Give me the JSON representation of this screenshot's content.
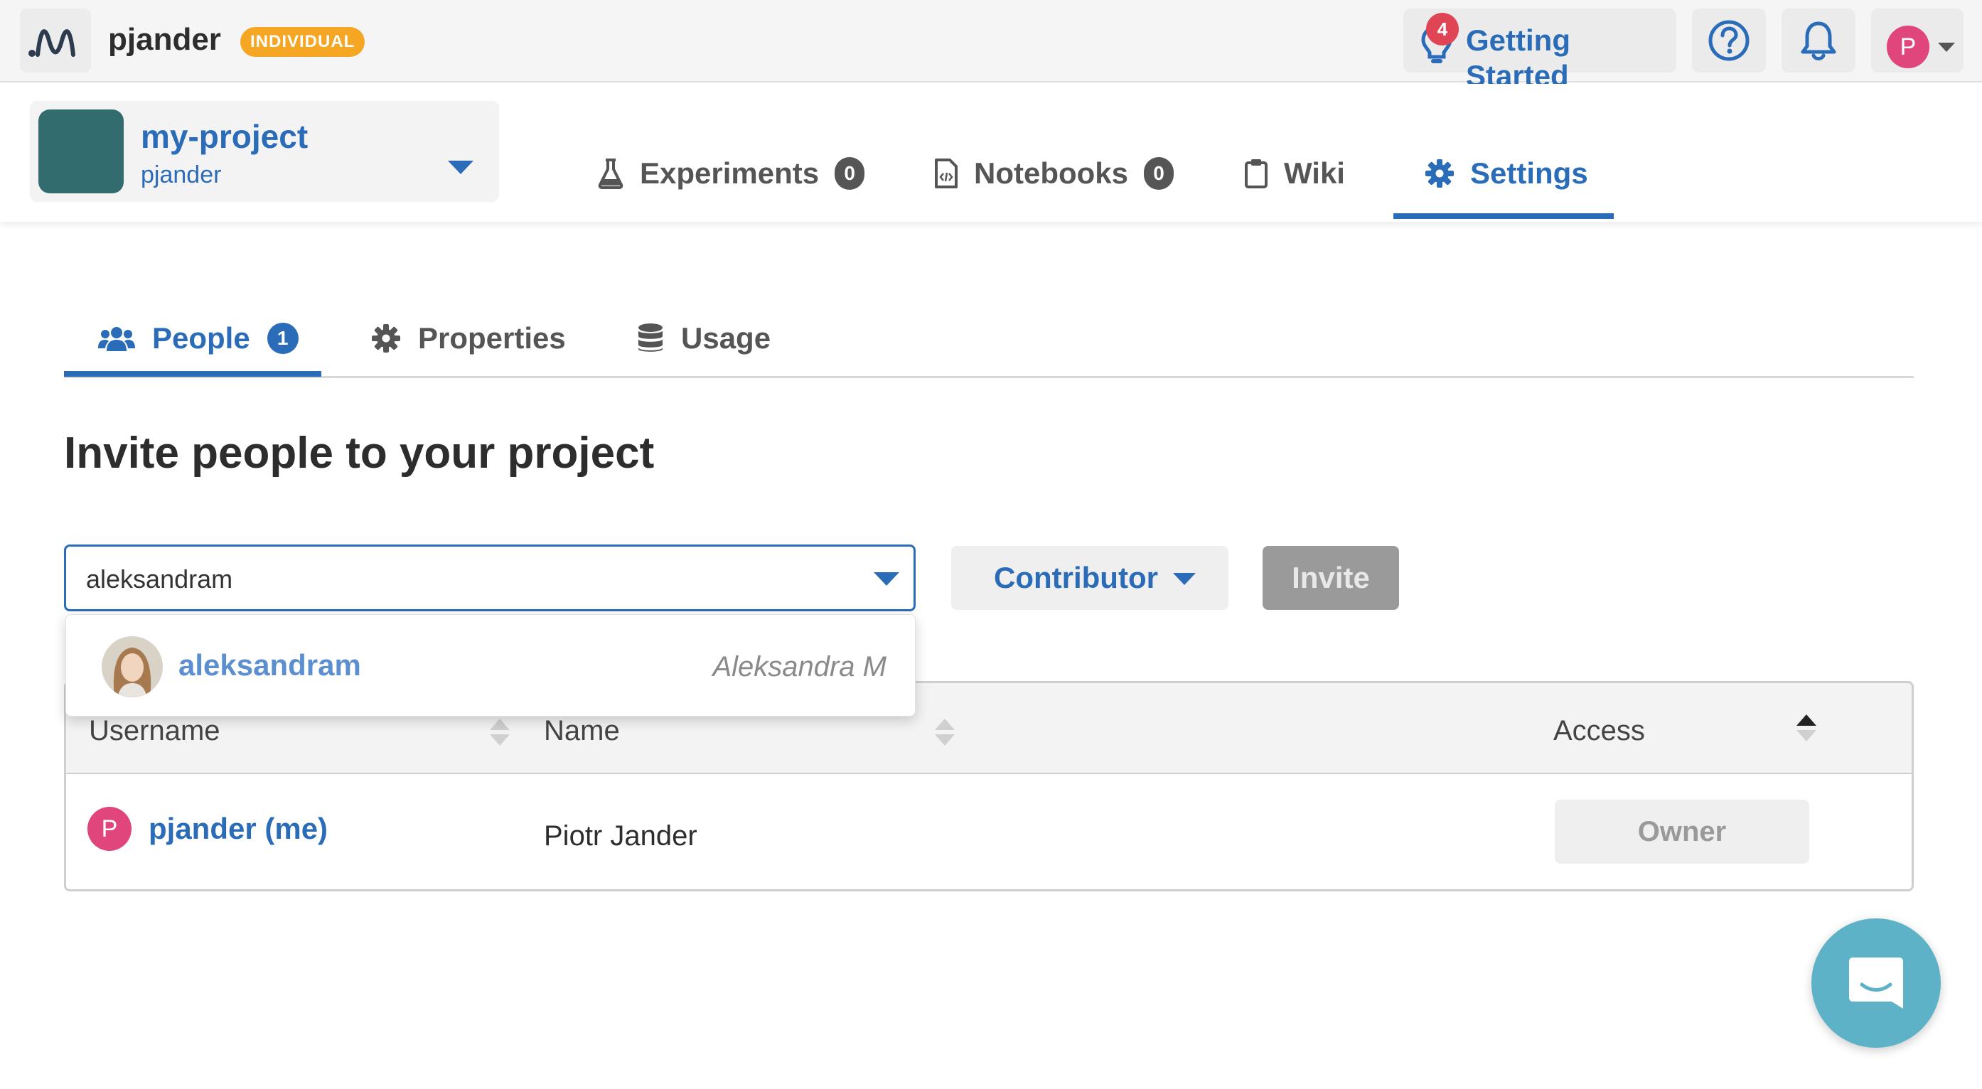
{
  "topbar": {
    "username": "pjander",
    "plan_badge": "INDIVIDUAL",
    "getting_started": {
      "label": "Getting Started",
      "count": "4"
    },
    "avatar_initial": "P"
  },
  "project": {
    "name": "my-project",
    "owner": "pjander",
    "color": "#326c6f"
  },
  "project_tabs": [
    {
      "label": "Experiments",
      "count": "0",
      "icon": "flask-icon"
    },
    {
      "label": "Notebooks",
      "count": "0",
      "icon": "notebook-icon"
    },
    {
      "label": "Wiki",
      "icon": "clipboard-icon"
    },
    {
      "label": "Settings",
      "icon": "gear-icon",
      "active": true
    }
  ],
  "settings_tabs": [
    {
      "label": "People",
      "count": "1",
      "icon": "users-icon",
      "active": true
    },
    {
      "label": "Properties",
      "icon": "gear-icon"
    },
    {
      "label": "Usage",
      "icon": "database-icon"
    }
  ],
  "invite": {
    "heading": "Invite people to your project",
    "search_value": "aleksandram",
    "role": "Contributor",
    "button": "Invite"
  },
  "suggestion": {
    "username": "aleksandram",
    "full_name": "Aleksandra M"
  },
  "table": {
    "columns": [
      "Username",
      "Name",
      "Access"
    ],
    "rows": [
      {
        "avatar_initial": "P",
        "username": "pjander (me)",
        "name": "Piotr Jander",
        "access": "Owner"
      }
    ]
  },
  "colors": {
    "accent": "#2b6cb8",
    "badge": "#f5a623",
    "notification": "#e04555",
    "avatar": "#e0457b",
    "chat": "#5db2c7"
  }
}
